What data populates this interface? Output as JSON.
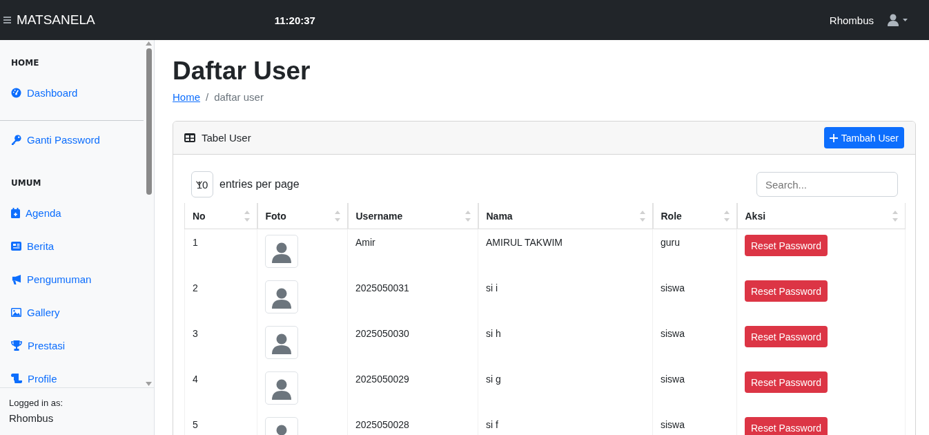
{
  "topbar": {
    "brand": "MATSANELA",
    "clock": "11:20:37",
    "user": "Rhombus"
  },
  "sidebar": {
    "sections": [
      {
        "heading": "HOME",
        "items": [
          {
            "label": "Dashboard"
          }
        ]
      },
      {
        "items": [
          {
            "label": "Ganti Password"
          }
        ]
      },
      {
        "heading": "UMUM",
        "items": [
          {
            "label": "Agenda"
          },
          {
            "label": "Berita"
          },
          {
            "label": "Pengumuman"
          },
          {
            "label": "Gallery"
          },
          {
            "label": "Prestasi"
          },
          {
            "label": "Profile"
          }
        ]
      }
    ],
    "footer": {
      "label": "Logged in as:",
      "user": "Rhombus"
    }
  },
  "page": {
    "title": "Daftar User",
    "breadcrumb_separator": "/",
    "breadcrumb": [
      {
        "label": "Home",
        "link": true
      },
      {
        "label": "daftar user",
        "link": false
      }
    ]
  },
  "card": {
    "title": "Tabel User",
    "add_button": "Tambah User",
    "per_page": "10",
    "per_page_label": "entries per page",
    "search": {
      "placeholder": "Search..."
    },
    "columns": [
      "No",
      "Foto",
      "Username",
      "Nama",
      "Role",
      "Aksi"
    ],
    "rows": [
      {
        "no": "1",
        "username": "Amir",
        "nama": "AMIRUL TAKWIM",
        "role": "guru",
        "action": "Reset Password"
      },
      {
        "no": "2",
        "username": "2025050031",
        "nama": "si i",
        "role": "siswa",
        "action": "Reset Password"
      },
      {
        "no": "3",
        "username": "2025050030",
        "nama": "si h",
        "role": "siswa",
        "action": "Reset Password"
      },
      {
        "no": "4",
        "username": "2025050029",
        "nama": "si g",
        "role": "siswa",
        "action": "Reset Password"
      },
      {
        "no": "5",
        "username": "2025050028",
        "nama": "si f",
        "role": "siswa",
        "action": "Reset Password"
      }
    ]
  }
}
